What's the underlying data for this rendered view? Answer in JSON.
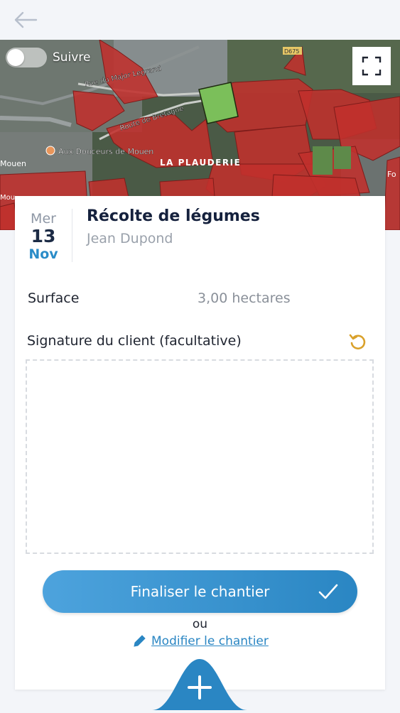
{
  "header": {
    "back_icon": "arrow-left-icon"
  },
  "map": {
    "toggle_label": "Suivre",
    "toggle_on": false,
    "fullscreen_icon": "fullscreen-icon",
    "labels": {
      "street1": "Rue du Major Legrand",
      "street2": "Route de Bretagne",
      "poi": "Aux Douceurs de Mouen",
      "place": "LA PLAUDERIE",
      "road": "D675",
      "town_left": "Mouen",
      "town_bottom": "Mou",
      "town_right": "Fo"
    },
    "colors": {
      "parcel": "#c0302c",
      "selected_parcel": "#7bbf5a"
    }
  },
  "event": {
    "day_of_week": "Mer",
    "day": "13",
    "month": "Nov",
    "title": "Récolte de légumes",
    "client": "Jean Dupond"
  },
  "details": {
    "surface_label": "Surface",
    "surface_value": "3,00 hectares"
  },
  "signature": {
    "label": "Signature du client (facultative)",
    "reset_icon": "undo-icon"
  },
  "actions": {
    "finalize_label": "Finaliser le chantier",
    "finalize_icon": "checkmark-icon",
    "or_text": "ou",
    "modify_label": "Modifier le chantier",
    "modify_icon": "pencil-icon",
    "add_icon": "plus-icon"
  },
  "colors": {
    "accent": "#2a86c3",
    "date_month": "#2a8cc8",
    "reset": "#d9a12b"
  }
}
